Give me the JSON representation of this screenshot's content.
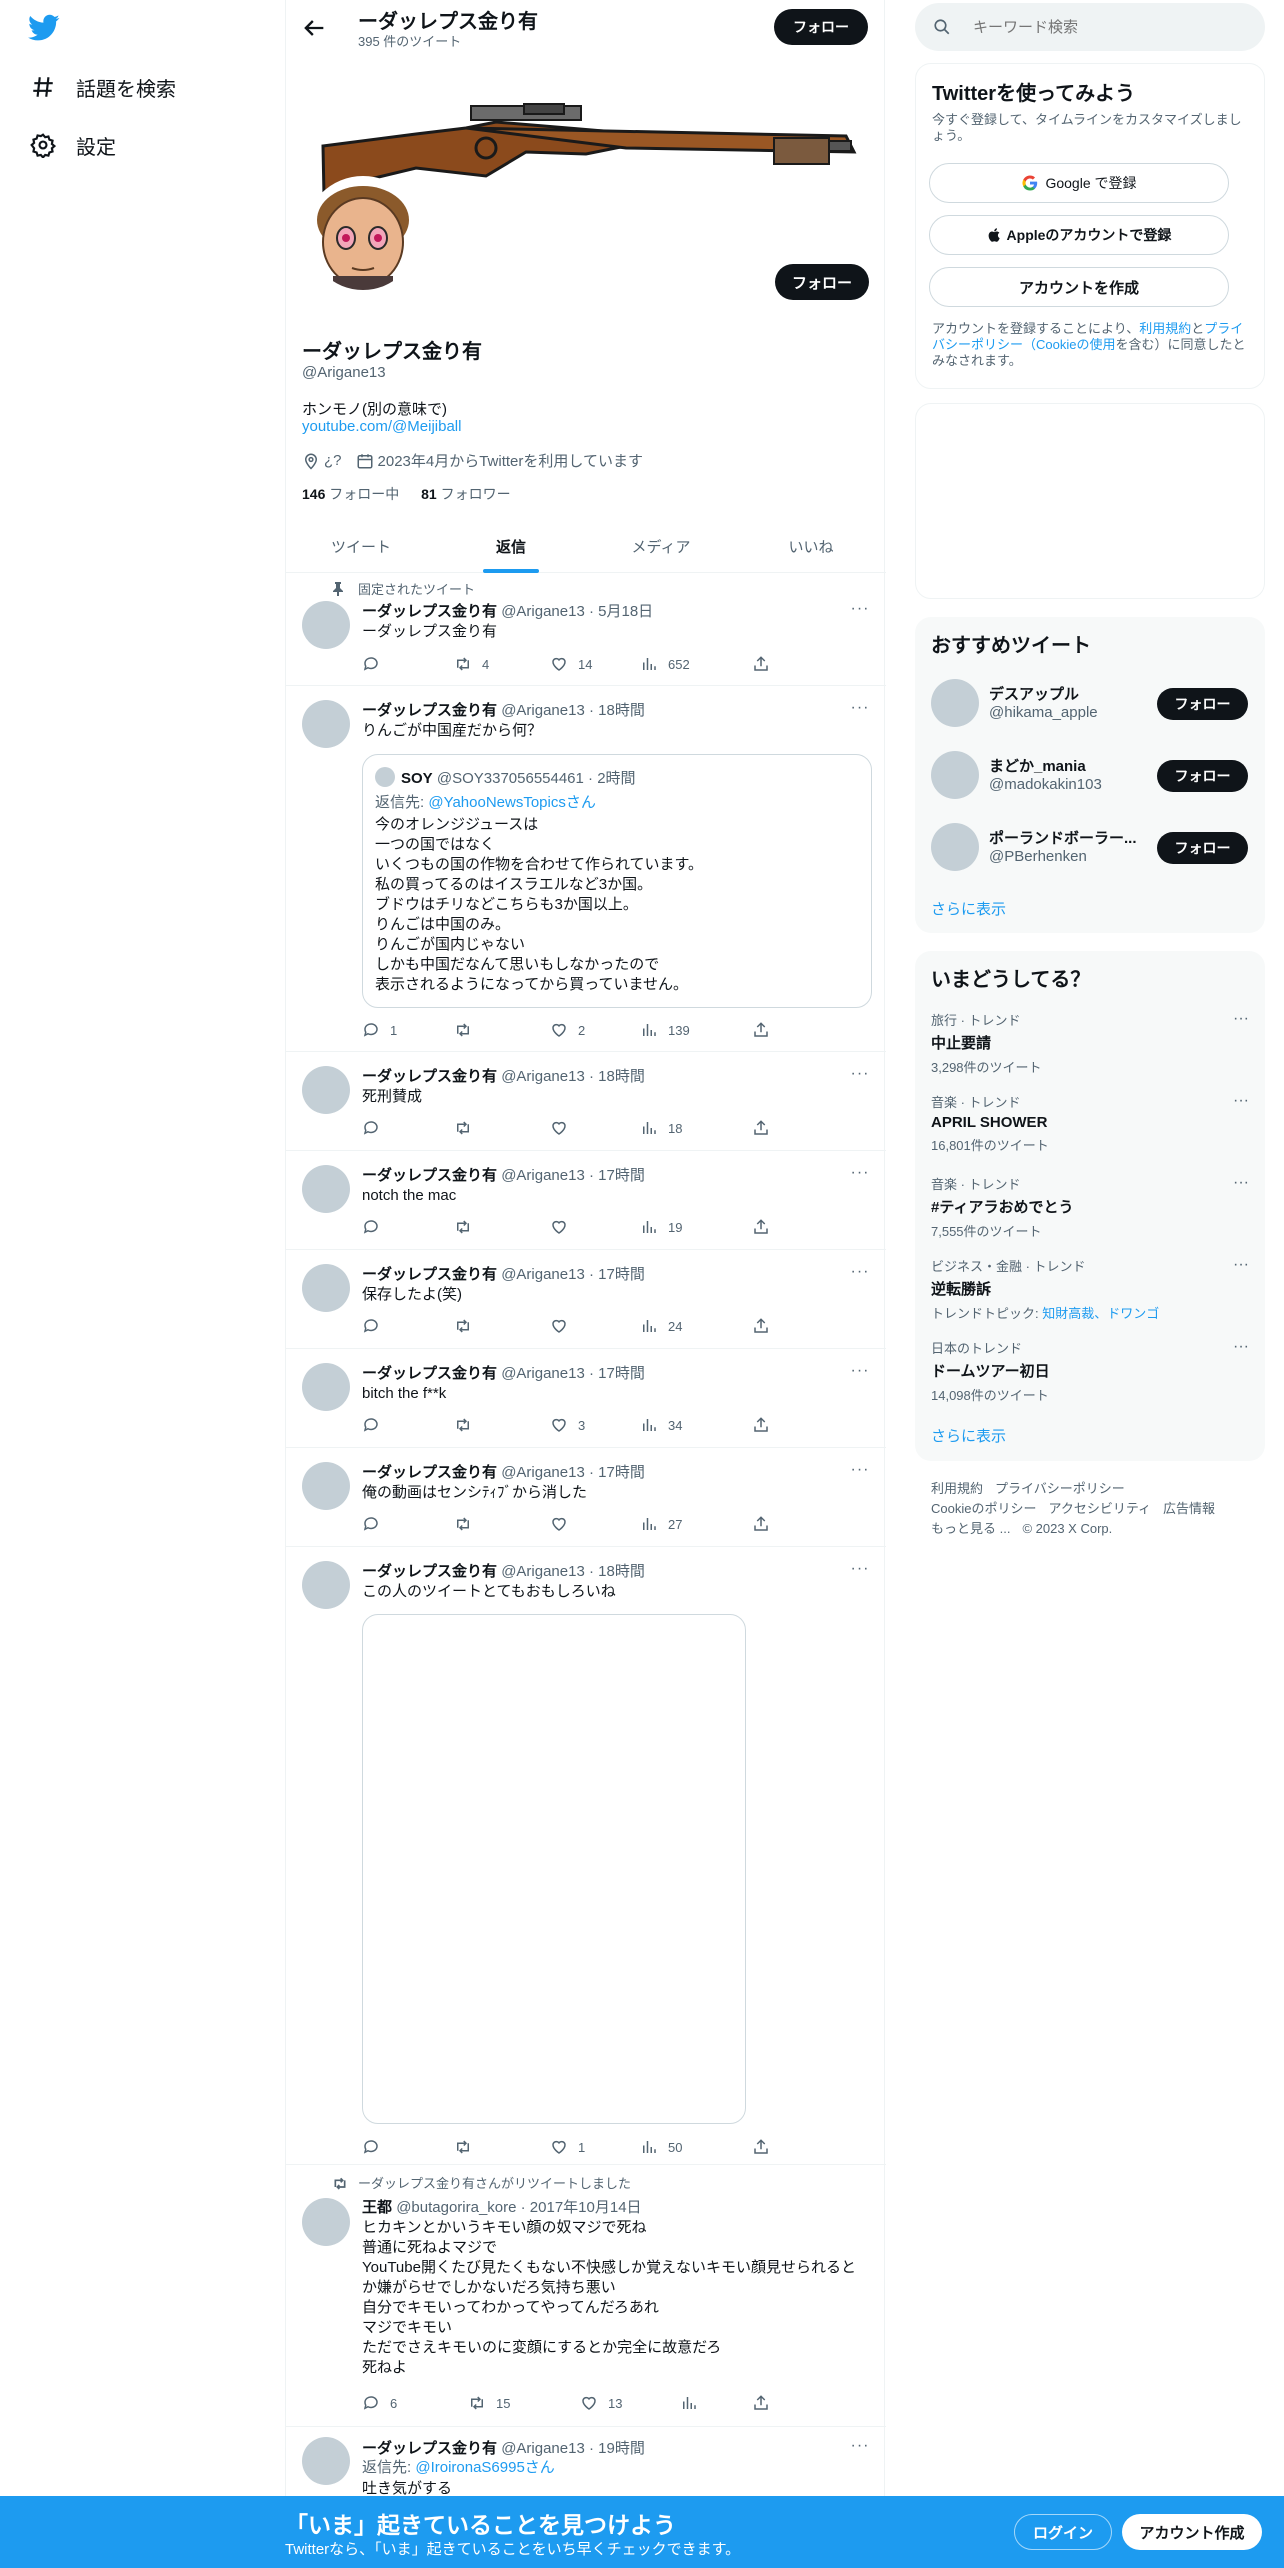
{
  "nav": {
    "explore": "話題を検索",
    "settings": "設定"
  },
  "profile": {
    "name": "ーダッレプス金り有",
    "tweet_count": "395 件のツイート",
    "handle": "@Arigane13",
    "bio": "ホンモノ(別の意味で)",
    "link": "youtube.com/@Meijiball",
    "location": "¿?",
    "joined": "2023年4月からTwitterを利用しています",
    "following_count": "146",
    "following_label": "フォロー中",
    "followers_count": "81",
    "followers_label": "フォロワー",
    "follow_label": "フォロー"
  },
  "tabs": [
    "ツイート",
    "返信",
    "メディア",
    "いいね"
  ],
  "pinned_label": "固定されたツイート",
  "tweets": [
    {
      "name": "ーダッレプス金り有",
      "meta": "@Arigane13 · 5月18日",
      "text": "ーダッレプス金り有",
      "reply": "",
      "retweet": "4",
      "like": "14",
      "views": "652"
    },
    {
      "name": "ーダッレプス金り有",
      "meta": "@Arigane13 · 18時間",
      "text": "りんごが中国産だから何？",
      "reply": "1",
      "retweet": "",
      "like": "2",
      "views": "139",
      "quote": {
        "name": "SOY",
        "meta": "@SOY337056554461 · 2時間",
        "reply_to_prefix": "返信先: ",
        "reply_to": "@YahooNewsTopicsさん",
        "text": "今のオレンジジュースは\n一つの国ではなく\nいくつもの国の作物を合わせて作られています。\n私の買ってるのはイスラエルなど3か国。\nブドウはチリなどこちらも3か国以上。\nりんごは中国のみ。\nりんごが国内じゃない\nしかも中国だなんて思いもしなかったので\n表示されるようになってから買っていません。"
      }
    },
    {
      "name": "ーダッレプス金り有",
      "meta": "@Arigane13 · 18時間",
      "text": "死刑賛成",
      "reply": "",
      "retweet": "",
      "like": "",
      "views": "18"
    },
    {
      "name": "ーダッレプス金り有",
      "meta": "@Arigane13 · 17時間",
      "text": "notch the mac",
      "reply": "",
      "retweet": "",
      "like": "",
      "views": "19"
    },
    {
      "name": "ーダッレプス金り有",
      "meta": "@Arigane13 · 17時間",
      "text": "保存したよ(笑)",
      "reply": "",
      "retweet": "",
      "like": "",
      "views": "24"
    },
    {
      "name": "ーダッレプス金り有",
      "meta": "@Arigane13 · 17時間",
      "text": "bitch the f**k",
      "reply": "",
      "retweet": "",
      "like": "3",
      "views": "34"
    },
    {
      "name": "ーダッレプス金り有",
      "meta": "@Arigane13 · 17時間",
      "text": "俺の動画はセンシﾃｨﾌﾞから消した",
      "reply": "",
      "retweet": "",
      "like": "",
      "views": "27"
    },
    {
      "name": "ーダッレプス金り有",
      "meta": "@Arigane13 · 18時間",
      "text": "この人のツイートとてもおもしろいね",
      "reply": "",
      "retweet": "",
      "like": "1",
      "views": "50"
    },
    {
      "retweeted_by": "ーダッレプス金り有さんがリツイートしました",
      "name": "王都",
      "meta": "@butagorira_kore · 2017年10月14日",
      "text": "ヒカキンとかいうキモい顔の奴マジで死ね\n普通に死ねよマジで\nYouTube開くたび見たくもない不快感しか覚えないキモい顔見せられると\nか嫌がらせでしかないだろ気持ち悪い\n自分でキモいってわかってやってんだろあれ\nマジでキモい\nただでさえキモいのに変顔にするとか完全に故意だろ\n死ねよ",
      "reply": "6",
      "retweet": "15",
      "like": "13",
      "views": ""
    },
    {
      "name": "ーダッレプス金り有",
      "meta": "@Arigane13 · 19時間",
      "reply_to_prefix": "返信先: ",
      "reply_to": "@IroironaS6995さん",
      "text": "吐き気がする"
    }
  ],
  "search": {
    "placeholder": "キーワード検索"
  },
  "signup": {
    "title": "Twitterを使ってみよう",
    "subtitle": "今すぐ登録して、タイムラインをカスタマイズしましょう。",
    "google": "Google で登録",
    "apple": "Appleのアカウントで登録",
    "create": "アカウントを作成",
    "legal_1": "アカウントを登録することにより、",
    "legal_terms": "利用規約",
    "legal_and": "と",
    "legal_privacy": "プライバシーポリシー",
    "legal_cookie": "（Cookieの使用",
    "legal_2": "を含む）に同意したとみなされます。"
  },
  "recommended": {
    "title": "おすすめツイート",
    "accounts": [
      {
        "name": "デスアップル",
        "handle": "@hikama_apple"
      },
      {
        "name": "まどか_mania",
        "handle": "@madokakin103"
      },
      {
        "name": "ポーランドボーラー...",
        "handle": "@PBerhenken"
      }
    ],
    "follow": "フォロー",
    "show_more": "さらに表示"
  },
  "trends": {
    "title": "いまどうしてる？",
    "items": [
      {
        "meta": "旅行 · トレンド",
        "name": "中止要請",
        "count": "3,298件のツイート"
      },
      {
        "meta": "音楽 · トレンド",
        "name": "APRIL SHOWER",
        "count": "16,801件のツイート"
      },
      {
        "meta": "音楽 · トレンド",
        "name": "#ティアラおめでとう",
        "count": "7,555件のツイート"
      },
      {
        "meta": "ビジネス・金融 · トレンド",
        "name": "逆転勝訴",
        "count_prefix": "トレンドトピック: ",
        "count_links": "知財高裁、ドワンゴ"
      },
      {
        "meta": "日本のトレンド",
        "name": "ドームツアー初日",
        "count": "14,098件のツイート"
      }
    ],
    "show_more": "さらに表示"
  },
  "footer": {
    "terms": "利用規約",
    "privacy": "プライバシーポリシー",
    "cookie": "Cookieのポリシー",
    "accessibility": "アクセシビリティ",
    "ads": "広告情報",
    "more": "もっと見る ...",
    "copyright": "© 2023 X Corp."
  },
  "bottombar": {
    "title": "「いま」起きていることを見つけよう",
    "subtitle": "Twitterなら、「いま」起きていることをいち早くチェックできます。",
    "login": "ログイン",
    "signup": "アカウント作成"
  },
  "colors": {
    "accent": "#1d9bf0",
    "text": "#0f1419",
    "muted": "#536471",
    "banner_rifle": "#8b4a1c"
  }
}
